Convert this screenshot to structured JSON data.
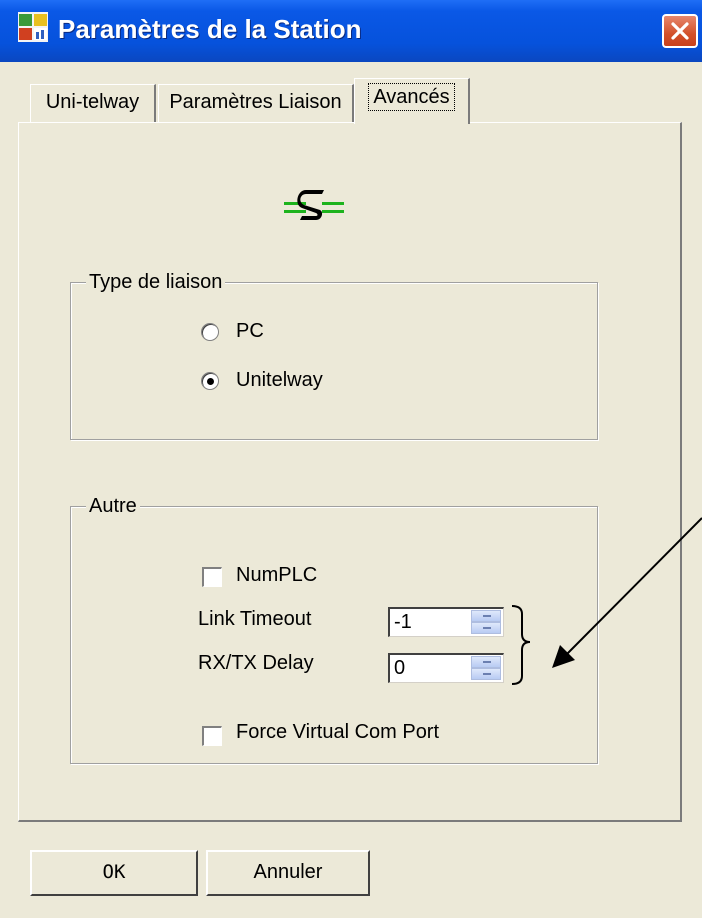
{
  "window": {
    "title": "Paramètres de la Station",
    "icon": "station-app-icon",
    "close_icon": "close-icon"
  },
  "tabs": [
    {
      "label": "Uni-telway",
      "active": false
    },
    {
      "label": "Paramètres Liaison",
      "active": false
    },
    {
      "label": "Avancés",
      "active": true
    }
  ],
  "panel": {
    "logo_icon": "s-link-logo-icon",
    "link_type": {
      "title": "Type de liaison",
      "options": [
        {
          "label": "PC",
          "checked": false
        },
        {
          "label": "Unitelway",
          "checked": true
        }
      ]
    },
    "other": {
      "title": "Autre",
      "numplc": {
        "label": "NumPLC",
        "checked": false
      },
      "link_timeout": {
        "label": "Link Timeout",
        "value": "-1"
      },
      "rxtx_delay": {
        "label": "RX/TX Delay",
        "value": "0"
      },
      "force_virtual_com": {
        "label": "Force Virtual Com Port",
        "checked": false
      }
    }
  },
  "buttons": {
    "ok": "OK",
    "cancel": "Annuler"
  },
  "colors": {
    "titlebar": "#0652dc",
    "dialog_bg": "#ece9d8",
    "logo_green": "#1db31d"
  }
}
